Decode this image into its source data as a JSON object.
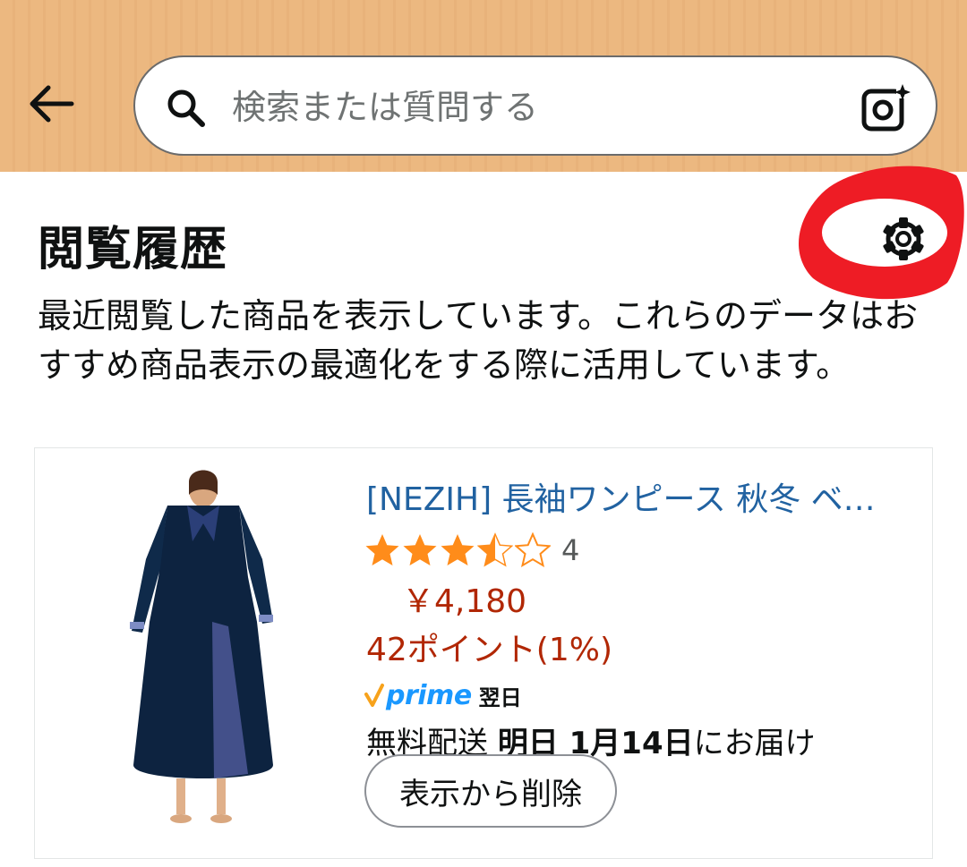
{
  "header": {
    "search_placeholder": "検索または質問する",
    "back_icon": "arrow-left-icon",
    "search_icon": "search-icon",
    "camera_icon": "camera-sparkle-icon"
  },
  "page": {
    "title": "閲覧履歴",
    "description": "最近閲覧した商品を表示しています。これらのデータはおすすめ商品表示の最適化をする際に活用しています。",
    "settings_icon": "gear-icon"
  },
  "product": {
    "title": "[NEZIH] 長袖ワンピース 秋冬 ベロア チャイナドレス",
    "rating": 3.5,
    "rating_count": "4",
    "price": "￥4,180",
    "points": "42ポイント(1%)",
    "prime_logo": "prime",
    "prime_tag": "翌日",
    "delivery_prefix": "無料配送",
    "delivery_date": "明日 1月14日",
    "delivery_suffix": "にお届け",
    "remove_label": "表示から削除"
  },
  "colors": {
    "header_bg": "#ecb880",
    "link": "#2162a1",
    "price": "#b12704",
    "star": "#ff8c1a",
    "prime": "#1a98ff",
    "annotation": "#ee1c25"
  }
}
